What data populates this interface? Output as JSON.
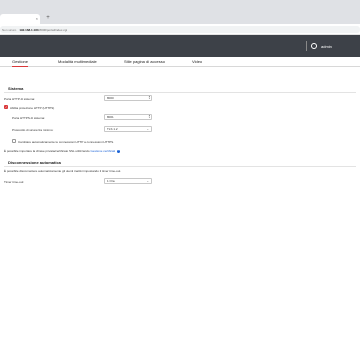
{
  "browser": {
    "tab_title": "",
    "new_tab_glyph": "+",
    "tab_close_glyph": "×",
    "url_security": "Non sicuro",
    "url_host": "192.168.1.183",
    "url_path": ":8000/portal/index.cgi"
  },
  "header": {
    "user_name": "admin",
    "user_icon": "user-circle-icon"
  },
  "tabs": [
    {
      "label": "Gestione",
      "active": true
    },
    {
      "label": "Modalità multimediale",
      "active": false
    },
    {
      "label": "Stile pagina di accesso",
      "active": false
    },
    {
      "label": "Video",
      "active": false
    }
  ],
  "sistema": {
    "title": "Sistema",
    "http_port": {
      "label": "Porta HTTP di sistema:",
      "value": "8000"
    },
    "https_enable": {
      "label": "Abilita protezione HTTP (HTTPS)",
      "checked": true
    },
    "https_port": {
      "label": "Porta HTTPS di sistema:",
      "value": "8001"
    },
    "protocol": {
      "label": "Protocollo di sicurezza minimo:",
      "value": "TLS 1.2"
    },
    "auto_switch": {
      "label": "Cambiare automaticamente le connessioni HTTP a connessioni HTTPS.",
      "checked": false
    },
    "cert_note": "È possibile importare la chiave privata/certificato SSL utilizzando",
    "cert_link": "Gestione certificati"
  },
  "disconnect": {
    "title": "Disconnessione automatica",
    "desc": "È possibile disconnettere automaticamente gli utenti inattivi impostando il timer time-out.",
    "timer": {
      "label": "Timer time-out:",
      "value": "1 Ora"
    }
  },
  "colors": {
    "accent": "#d9383a",
    "header_bg": "#3d4148",
    "link": "#1a62d6"
  }
}
